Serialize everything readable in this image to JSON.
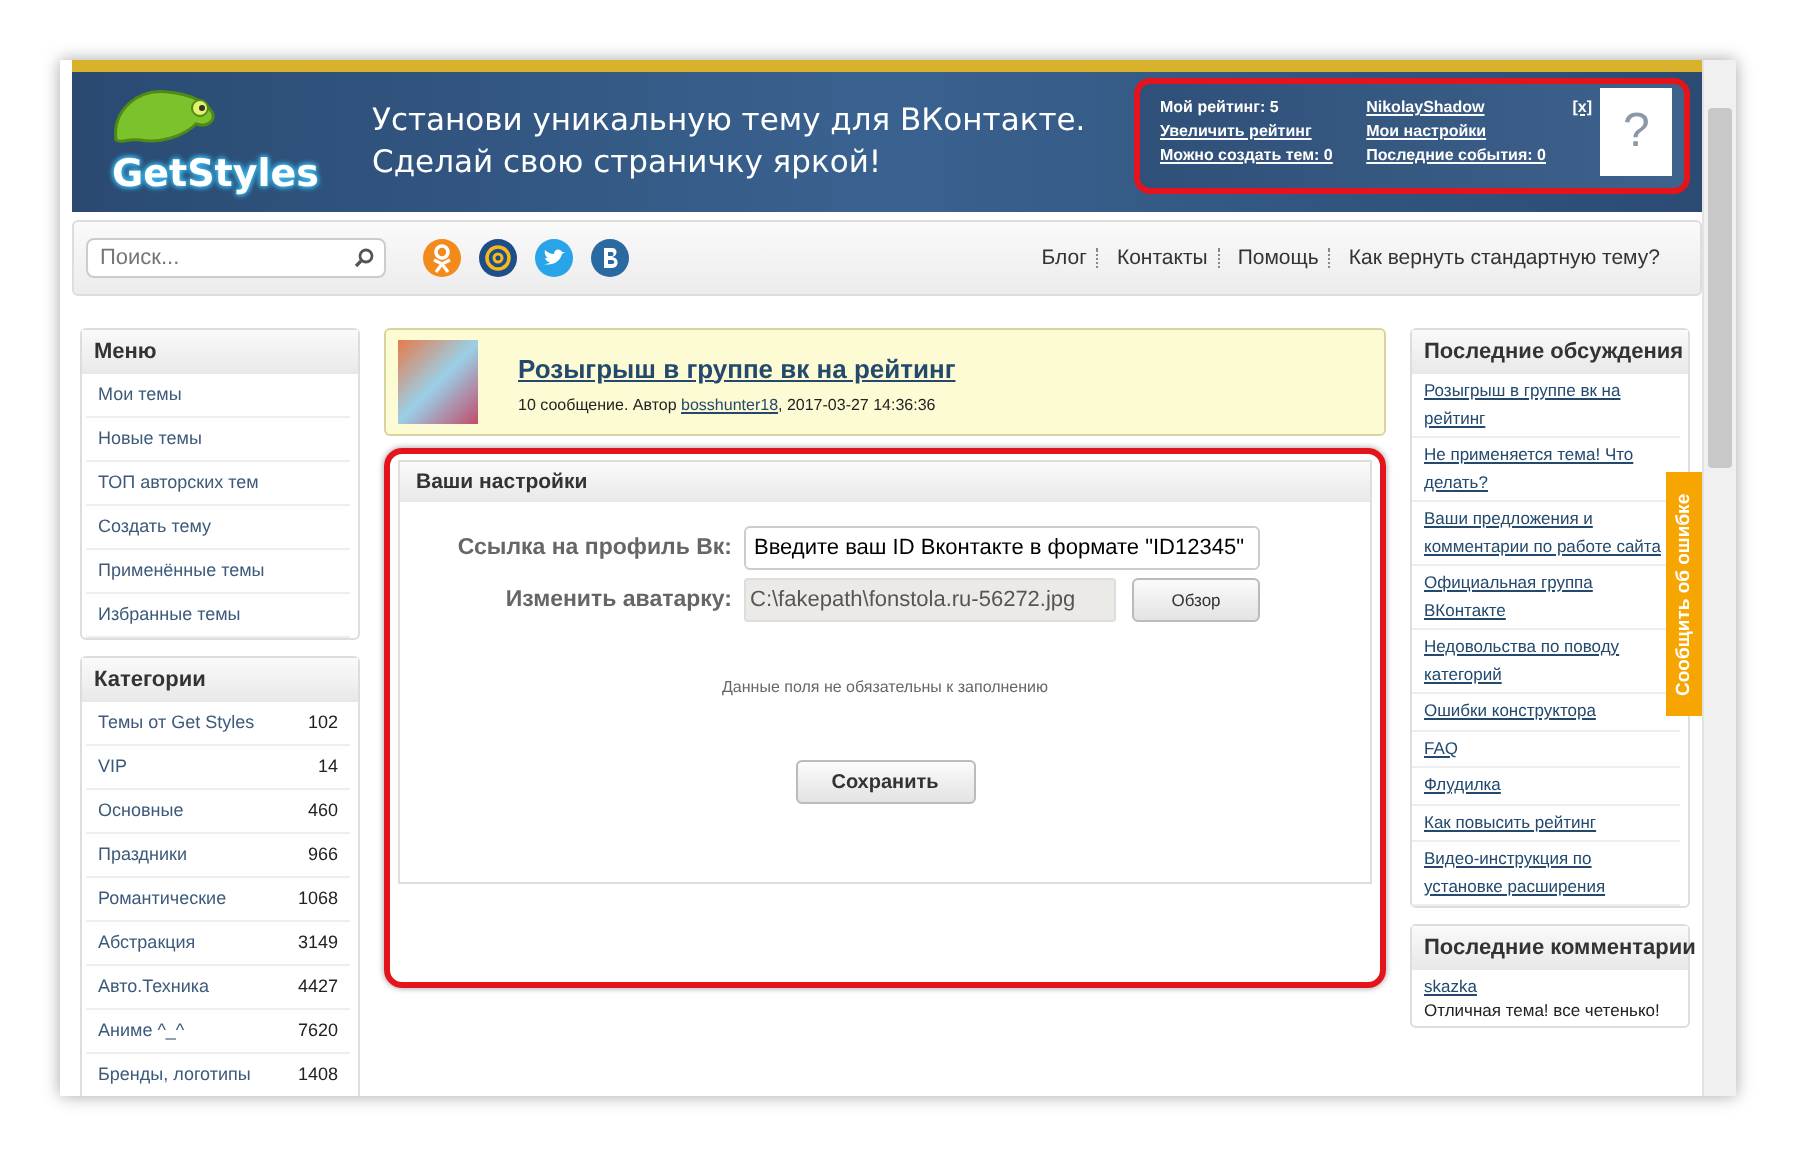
{
  "header": {
    "logo_text": "GetStyles",
    "tagline": [
      "Установи уникальную тему для ВКонтакте.",
      "Сделай свою страничку яркой!"
    ]
  },
  "user_box": {
    "rating": "Мой рейтинг: 5",
    "left_links": [
      "Увеличить рейтинг",
      "Можно создать тем: 0"
    ],
    "username": "NikolayShadow",
    "right_links": [
      "Мои настройки",
      "Последние события: 0"
    ],
    "close": "[x]",
    "avatar": "?"
  },
  "toolbar": {
    "search": {
      "placeholder": "Поиск..."
    },
    "nav": [
      "Блог",
      "Контакты",
      "Помощь",
      "Как вернуть стандартную тему?"
    ]
  },
  "menu": {
    "title": "Меню",
    "items": [
      "Мои темы",
      "Новые темы",
      "ТОП авторских тем",
      "Создать тему",
      "Применённые темы",
      "Избранные темы"
    ]
  },
  "categories": {
    "title": "Категории",
    "items": [
      {
        "name": "Темы от Get Styles",
        "count": "102"
      },
      {
        "name": "VIP",
        "count": "14"
      },
      {
        "name": "Основные",
        "count": "460"
      },
      {
        "name": "Праздники",
        "count": "966"
      },
      {
        "name": "Романтические",
        "count": "1068"
      },
      {
        "name": "Абстракция",
        "count": "3149"
      },
      {
        "name": "Авто.Техника",
        "count": "4427"
      },
      {
        "name": "Аниме ^_^",
        "count": "7620"
      },
      {
        "name": "Бренды, логотипы",
        "count": "1408"
      }
    ]
  },
  "announcement": {
    "title": "Розыгрыш в группе вк на рейтинг",
    "meta_prefix": "10 сообщение. Автор",
    "author": "bosshunter18",
    "meta_suffix": ", 2017-03-27 14:36:36"
  },
  "settings": {
    "title": "Ваши настройки",
    "fields": [
      {
        "kind": "text",
        "label": "Ссылка на профиль Вк:",
        "value": "Введите ваш ID Вконтакте в формате \"ID12345\""
      },
      {
        "kind": "file",
        "label": "Изменить аватарку:",
        "value": "C:\\fakepath\\fonstola.ru-56272.jpg",
        "button": "Обзор"
      }
    ],
    "note": "Данные поля не обязательны к заполнению",
    "save": "Сохранить"
  },
  "discussions": {
    "title": "Последние обсуждения",
    "items": [
      "Розыгрыш в группе вк на рейтинг",
      "Не применяется тема! Что делать?",
      "Ваши предложения и комментарии по работе сайта",
      "Официальная группа ВКонтакте",
      "Недовольства по поводу категорий",
      "Ошибки конструктора",
      "FAQ",
      "Флудилка",
      "Как повысить рейтинг",
      "Видео-инструкция по установке расширения"
    ]
  },
  "comments": {
    "title": "Последние комментарии",
    "items": [
      {
        "author": "skazka",
        "text": "Отличная тема! все четенько!"
      }
    ]
  },
  "feedback_tab": "Сообщить об ошибке"
}
